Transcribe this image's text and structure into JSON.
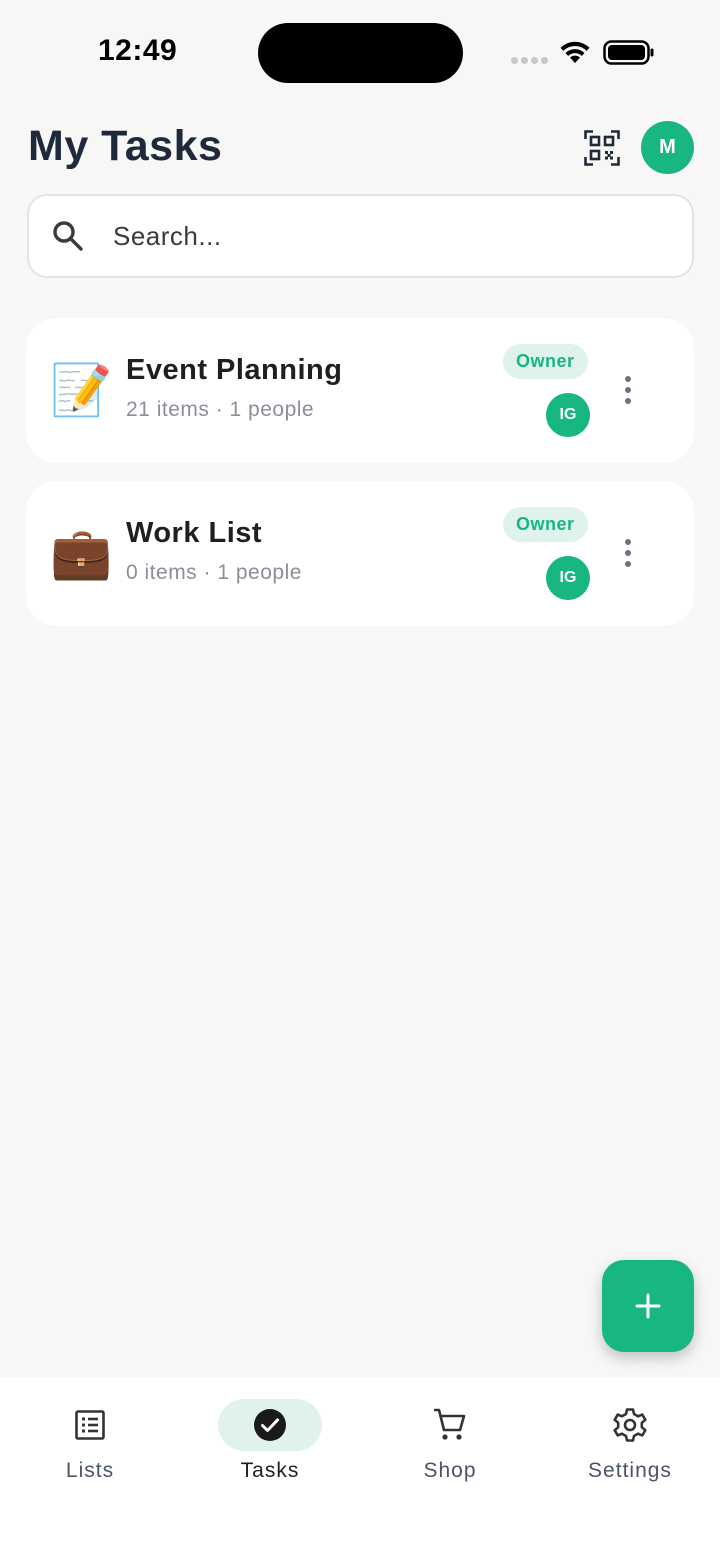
{
  "status_bar": {
    "time": "12:49"
  },
  "header": {
    "title": "My Tasks",
    "avatar_initial": "M"
  },
  "search": {
    "placeholder": "Search..."
  },
  "lists": [
    {
      "emoji": "📝",
      "title": "Event Planning",
      "meta": "21 items · 1 people",
      "badge": "Owner",
      "member_initials": "IG"
    },
    {
      "emoji": "💼",
      "title": "Work List",
      "meta": "0 items · 1 people",
      "badge": "Owner",
      "member_initials": "IG"
    }
  ],
  "nav": {
    "items": [
      {
        "label": "Lists",
        "icon": "list-icon"
      },
      {
        "label": "Tasks",
        "icon": "check-circle-icon",
        "active": true
      },
      {
        "label": "Shop",
        "icon": "cart-icon"
      },
      {
        "label": "Settings",
        "icon": "gear-icon"
      }
    ]
  },
  "fab": {
    "icon": "plus-icon"
  },
  "colors": {
    "accent": "#17b77f",
    "accent_soft": "#dff3ea",
    "background": "#f7f7f5"
  }
}
